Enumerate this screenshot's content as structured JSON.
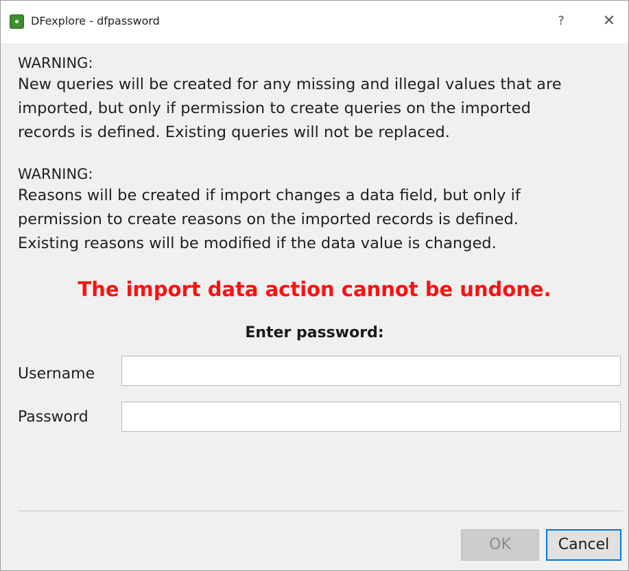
{
  "window": {
    "title": "DFexplore - dfpassword",
    "help_label": "?",
    "close_label": "✕"
  },
  "warning1": {
    "title": "WARNING:",
    "lines": [
      "New queries will be created for any missing and illegal values that are",
      "imported, but only if permission to create queries on the imported",
      "records is defined. Existing queries will not be replaced."
    ]
  },
  "warning2": {
    "title": "WARNING:",
    "lines": [
      "Reasons will be created if import changes a data field, but only if",
      "permission to create reasons on the imported records is defined.",
      "Existing reasons will be modified if the data value is changed."
    ]
  },
  "alert": {
    "text": "The import data action cannot be undone.",
    "color": "#ff1010"
  },
  "form": {
    "heading": "Enter password:",
    "username_label": "Username",
    "username_value": "",
    "password_label": "Password",
    "password_value": ""
  },
  "buttons": {
    "ok_label": "OK",
    "ok_enabled": false,
    "cancel_label": "Cancel"
  },
  "colors": {
    "background": "#f0f0f0",
    "titlebar": "#ffffff",
    "focus_border": "#0078d7",
    "disabled_button": "#cccccc"
  },
  "icons": {
    "app": "dfexplore-app-icon",
    "help": "help-icon",
    "close": "close-icon"
  }
}
